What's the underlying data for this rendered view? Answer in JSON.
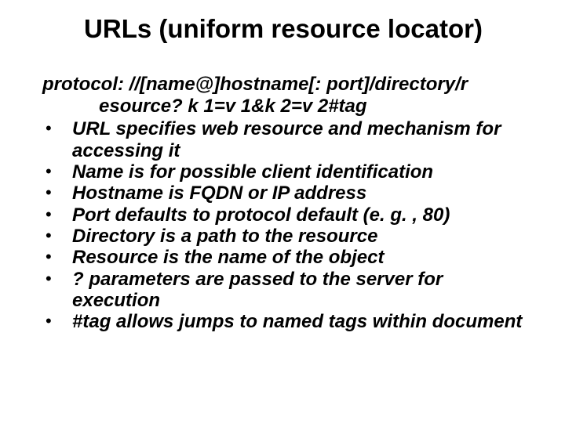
{
  "title": "URLs (uniform resource locator)",
  "syntax": {
    "line1": "protocol: //[name@]hostname[: port]/directory/r",
    "line2_a": "esource? k 1=v 1",
    "amp": "&",
    "line2_b": "k 2=v 2#tag"
  },
  "bullets": [
    "URL specifies web resource and mechanism for accessing it",
    "Name is for possible client identification",
    "Hostname is FQDN or IP address",
    "Port defaults to protocol default (e. g. , 80)",
    "Directory is a path to the resource",
    "Resource is the name of the object",
    "? parameters are passed to the server for execution",
    "#tag allows jumps to named tags within document"
  ]
}
